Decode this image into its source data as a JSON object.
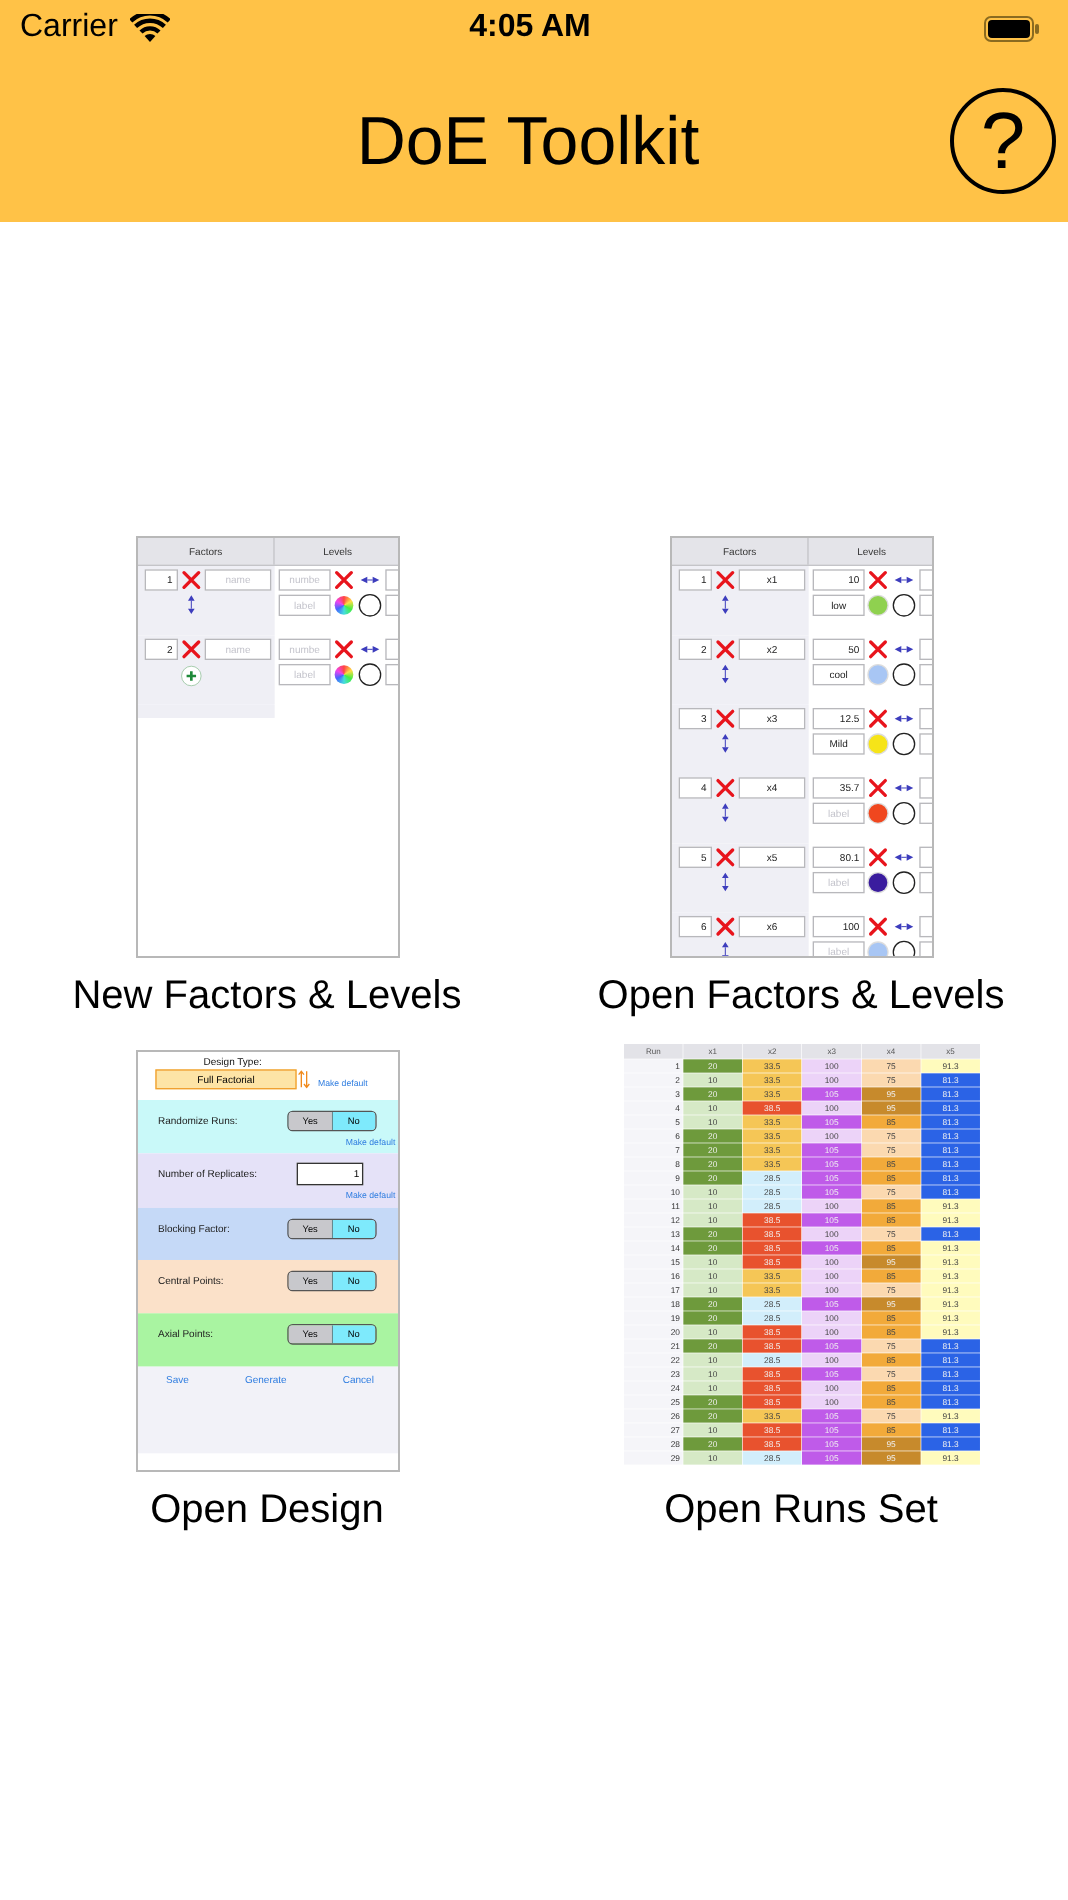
{
  "status_bar": {
    "carrier": "Carrier",
    "time": "4:05 AM"
  },
  "nav_bar": {
    "title": "DoE Toolkit",
    "help_button": "?"
  },
  "tiles": [
    {
      "kind": "factors",
      "caption": "New Factors & Levels",
      "headers": [
        "Factors",
        "Levels"
      ],
      "factors": [
        {
          "number": "1",
          "name": {
            "placeholder": "name"
          },
          "kind": "reorder",
          "level": {
            "number": {
              "placeholder": "numbe"
            },
            "label": {
              "placeholder": "label"
            }
          }
        },
        {
          "number": "2",
          "name": {
            "placeholder": "name"
          },
          "kind": "add",
          "level": {
            "number": {
              "placeholder": "numbe"
            },
            "label": {
              "placeholder": "label"
            }
          }
        }
      ]
    },
    {
      "kind": "factors",
      "caption": "Open Factors & Levels",
      "headers": [
        "Factors",
        "Levels"
      ],
      "factors": [
        {
          "number": "1",
          "name": {
            "value": "x1"
          },
          "kind": "reorder",
          "level": {
            "number": {
              "value": "10"
            },
            "label": {
              "value": "low"
            },
            "color": "#8fd14f"
          }
        },
        {
          "number": "2",
          "name": {
            "value": "x2"
          },
          "kind": "reorder",
          "level": {
            "number": {
              "value": "50"
            },
            "label": {
              "value": "cool"
            },
            "color": "#a8c6f4"
          }
        },
        {
          "number": "3",
          "name": {
            "value": "x3"
          },
          "kind": "reorder",
          "level": {
            "number": {
              "value": "12.5"
            },
            "label": {
              "value": "Mild"
            },
            "color": "#f6e418"
          }
        },
        {
          "number": "4",
          "name": {
            "value": "x4"
          },
          "kind": "reorder",
          "level": {
            "number": {
              "value": "35.7"
            },
            "label": {
              "placeholder": "label"
            },
            "color": "#f0471f"
          }
        },
        {
          "number": "5",
          "name": {
            "value": "x5"
          },
          "kind": "reorder",
          "level": {
            "number": {
              "value": "80.1"
            },
            "label": {
              "placeholder": "label"
            },
            "color": "#3a1c9e"
          }
        },
        {
          "number": "6",
          "name": {
            "value": "x6"
          },
          "kind": "reorder",
          "level": {
            "number": {
              "value": "100"
            },
            "label": {
              "placeholder": "label"
            },
            "color": "#a8c6f4"
          }
        }
      ]
    },
    {
      "kind": "design",
      "caption": "Open Design",
      "design_type_label": "Design Type:",
      "design_type": "Full Factorial",
      "make_default": "Make default",
      "sections": [
        {
          "kind": "toggle",
          "label": "Randomize Runs:",
          "color": "#c9f9f9",
          "options": [
            {
              "label": "Yes",
              "selected": false
            },
            {
              "label": "No",
              "selected": true
            }
          ],
          "make_default": "Make default"
        },
        {
          "kind": "field",
          "label": "Number of Replicates:",
          "color": "#e5e2f8",
          "value": "1",
          "make_default": "Make default"
        },
        {
          "kind": "toggle",
          "label": "Blocking Factor:",
          "color": "#c5d9f7",
          "options": [
            {
              "label": "Yes",
              "selected": false
            },
            {
              "label": "No",
              "selected": true
            }
          ]
        },
        {
          "kind": "toggle",
          "label": "Central Points:",
          "color": "#fbe1c9",
          "options": [
            {
              "label": "Yes",
              "selected": false
            },
            {
              "label": "No",
              "selected": true
            }
          ]
        },
        {
          "kind": "toggle",
          "label": "Axial Points:",
          "color": "#a9f4a1",
          "options": [
            {
              "label": "Yes",
              "selected": false
            },
            {
              "label": "No",
              "selected": true
            }
          ]
        }
      ],
      "buttons": [
        "Save",
        "Generate",
        "Cancel"
      ]
    },
    {
      "kind": "runs",
      "caption": "Open Runs Set",
      "columns": [
        "Run",
        "x1",
        "x2",
        "x3",
        "x4",
        "x5"
      ],
      "rows": [
        {
          "cells": [
            {
              "text": "1"
            },
            {
              "text": "20",
              "color": "#6e9a3c"
            },
            {
              "text": "33.5",
              "color": "#f5c656"
            },
            {
              "text": "100",
              "color": "#ecd3f8"
            },
            {
              "text": "75",
              "color": "#fbd9b0"
            },
            {
              "text": "91.3",
              "color": "#fffbbd"
            }
          ]
        },
        {
          "cells": [
            {
              "text": "2"
            },
            {
              "text": "10",
              "color": "#d6e9c6"
            },
            {
              "text": "33.5",
              "color": "#f5c656"
            },
            {
              "text": "100",
              "color": "#ecd3f8"
            },
            {
              "text": "75",
              "color": "#fbd9b0"
            },
            {
              "text": "81.3",
              "color": "#2b63e6"
            }
          ]
        },
        {
          "cells": [
            {
              "text": "3"
            },
            {
              "text": "20",
              "color": "#6e9a3c"
            },
            {
              "text": "33.5",
              "color": "#f5c656"
            },
            {
              "text": "105",
              "color": "#bf5be9"
            },
            {
              "text": "95",
              "color": "#c78a2c"
            },
            {
              "text": "81.3",
              "color": "#2b63e6"
            }
          ]
        },
        {
          "cells": [
            {
              "text": "4"
            },
            {
              "text": "10",
              "color": "#d6e9c6"
            },
            {
              "text": "38.5",
              "color": "#e8522e"
            },
            {
              "text": "100",
              "color": "#ecd3f8"
            },
            {
              "text": "95",
              "color": "#c78a2c"
            },
            {
              "text": "81.3",
              "color": "#2b63e6"
            }
          ]
        },
        {
          "cells": [
            {
              "text": "5"
            },
            {
              "text": "10",
              "color": "#d6e9c6"
            },
            {
              "text": "33.5",
              "color": "#f5c656"
            },
            {
              "text": "105",
              "color": "#bf5be9"
            },
            {
              "text": "85",
              "color": "#f2aa3a"
            },
            {
              "text": "81.3",
              "color": "#2b63e6"
            }
          ]
        },
        {
          "cells": [
            {
              "text": "6"
            },
            {
              "text": "20",
              "color": "#6e9a3c"
            },
            {
              "text": "33.5",
              "color": "#f5c656"
            },
            {
              "text": "100",
              "color": "#ecd3f8"
            },
            {
              "text": "75",
              "color": "#fbd9b0"
            },
            {
              "text": "81.3",
              "color": "#2b63e6"
            }
          ]
        },
        {
          "cells": [
            {
              "text": "7"
            },
            {
              "text": "20",
              "color": "#6e9a3c"
            },
            {
              "text": "33.5",
              "color": "#f5c656"
            },
            {
              "text": "105",
              "color": "#bf5be9"
            },
            {
              "text": "75",
              "color": "#fbd9b0"
            },
            {
              "text": "81.3",
              "color": "#2b63e6"
            }
          ]
        },
        {
          "cells": [
            {
              "text": "8"
            },
            {
              "text": "20",
              "color": "#6e9a3c"
            },
            {
              "text": "33.5",
              "color": "#f5c656"
            },
            {
              "text": "105",
              "color": "#bf5be9"
            },
            {
              "text": "85",
              "color": "#f2aa3a"
            },
            {
              "text": "81.3",
              "color": "#2b63e6"
            }
          ]
        },
        {
          "cells": [
            {
              "text": "9"
            },
            {
              "text": "20",
              "color": "#6e9a3c"
            },
            {
              "text": "28.5",
              "color": "#d2eefb"
            },
            {
              "text": "105",
              "color": "#bf5be9"
            },
            {
              "text": "85",
              "color": "#f2aa3a"
            },
            {
              "text": "81.3",
              "color": "#2b63e6"
            }
          ]
        },
        {
          "cells": [
            {
              "text": "10"
            },
            {
              "text": "10",
              "color": "#d6e9c6"
            },
            {
              "text": "28.5",
              "color": "#d2eefb"
            },
            {
              "text": "105",
              "color": "#bf5be9"
            },
            {
              "text": "75",
              "color": "#fbd9b0"
            },
            {
              "text": "81.3",
              "color": "#2b63e6"
            }
          ]
        },
        {
          "cells": [
            {
              "text": "11"
            },
            {
              "text": "10",
              "color": "#d6e9c6"
            },
            {
              "text": "28.5",
              "color": "#d2eefb"
            },
            {
              "text": "100",
              "color": "#ecd3f8"
            },
            {
              "text": "85",
              "color": "#f2aa3a"
            },
            {
              "text": "91.3",
              "color": "#fffbbd"
            }
          ]
        },
        {
          "cells": [
            {
              "text": "12"
            },
            {
              "text": "10",
              "color": "#d6e9c6"
            },
            {
              "text": "38.5",
              "color": "#e8522e"
            },
            {
              "text": "105",
              "color": "#bf5be9"
            },
            {
              "text": "85",
              "color": "#f2aa3a"
            },
            {
              "text": "91.3",
              "color": "#fffbbd"
            }
          ]
        },
        {
          "cells": [
            {
              "text": "13"
            },
            {
              "text": "20",
              "color": "#6e9a3c"
            },
            {
              "text": "38.5",
              "color": "#e8522e"
            },
            {
              "text": "100",
              "color": "#ecd3f8"
            },
            {
              "text": "75",
              "color": "#fbd9b0"
            },
            {
              "text": "81.3",
              "color": "#2b63e6"
            }
          ]
        },
        {
          "cells": [
            {
              "text": "14"
            },
            {
              "text": "20",
              "color": "#6e9a3c"
            },
            {
              "text": "38.5",
              "color": "#e8522e"
            },
            {
              "text": "105",
              "color": "#bf5be9"
            },
            {
              "text": "85",
              "color": "#f2aa3a"
            },
            {
              "text": "91.3",
              "color": "#fffbbd"
            }
          ]
        },
        {
          "cells": [
            {
              "text": "15"
            },
            {
              "text": "10",
              "color": "#d6e9c6"
            },
            {
              "text": "38.5",
              "color": "#e8522e"
            },
            {
              "text": "100",
              "color": "#ecd3f8"
            },
            {
              "text": "95",
              "color": "#c78a2c"
            },
            {
              "text": "91.3",
              "color": "#fffbbd"
            }
          ]
        },
        {
          "cells": [
            {
              "text": "16"
            },
            {
              "text": "10",
              "color": "#d6e9c6"
            },
            {
              "text": "33.5",
              "color": "#f5c656"
            },
            {
              "text": "100",
              "color": "#ecd3f8"
            },
            {
              "text": "85",
              "color": "#f2aa3a"
            },
            {
              "text": "91.3",
              "color": "#fffbbd"
            }
          ]
        },
        {
          "cells": [
            {
              "text": "17"
            },
            {
              "text": "10",
              "color": "#d6e9c6"
            },
            {
              "text": "33.5",
              "color": "#f5c656"
            },
            {
              "text": "100",
              "color": "#ecd3f8"
            },
            {
              "text": "75",
              "color": "#fbd9b0"
            },
            {
              "text": "91.3",
              "color": "#fffbbd"
            }
          ]
        },
        {
          "cells": [
            {
              "text": "18"
            },
            {
              "text": "20",
              "color": "#6e9a3c"
            },
            {
              "text": "28.5",
              "color": "#d2eefb"
            },
            {
              "text": "105",
              "color": "#bf5be9"
            },
            {
              "text": "95",
              "color": "#c78a2c"
            },
            {
              "text": "91.3",
              "color": "#fffbbd"
            }
          ]
        },
        {
          "cells": [
            {
              "text": "19"
            },
            {
              "text": "20",
              "color": "#6e9a3c"
            },
            {
              "text": "28.5",
              "color": "#d2eefb"
            },
            {
              "text": "100",
              "color": "#ecd3f8"
            },
            {
              "text": "85",
              "color": "#f2aa3a"
            },
            {
              "text": "91.3",
              "color": "#fffbbd"
            }
          ]
        },
        {
          "cells": [
            {
              "text": "20"
            },
            {
              "text": "10",
              "color": "#d6e9c6"
            },
            {
              "text": "38.5",
              "color": "#e8522e"
            },
            {
              "text": "100",
              "color": "#ecd3f8"
            },
            {
              "text": "85",
              "color": "#f2aa3a"
            },
            {
              "text": "91.3",
              "color": "#fffbbd"
            }
          ]
        },
        {
          "cells": [
            {
              "text": "21"
            },
            {
              "text": "20",
              "color": "#6e9a3c"
            },
            {
              "text": "38.5",
              "color": "#e8522e"
            },
            {
              "text": "105",
              "color": "#bf5be9"
            },
            {
              "text": "75",
              "color": "#fbd9b0"
            },
            {
              "text": "81.3",
              "color": "#2b63e6"
            }
          ]
        },
        {
          "cells": [
            {
              "text": "22"
            },
            {
              "text": "10",
              "color": "#d6e9c6"
            },
            {
              "text": "28.5",
              "color": "#d2eefb"
            },
            {
              "text": "100",
              "color": "#ecd3f8"
            },
            {
              "text": "85",
              "color": "#f2aa3a"
            },
            {
              "text": "81.3",
              "color": "#2b63e6"
            }
          ]
        },
        {
          "cells": [
            {
              "text": "23"
            },
            {
              "text": "10",
              "color": "#d6e9c6"
            },
            {
              "text": "38.5",
              "color": "#e8522e"
            },
            {
              "text": "105",
              "color": "#bf5be9"
            },
            {
              "text": "75",
              "color": "#fbd9b0"
            },
            {
              "text": "81.3",
              "color": "#2b63e6"
            }
          ]
        },
        {
          "cells": [
            {
              "text": "24"
            },
            {
              "text": "10",
              "color": "#d6e9c6"
            },
            {
              "text": "38.5",
              "color": "#e8522e"
            },
            {
              "text": "100",
              "color": "#ecd3f8"
            },
            {
              "text": "85",
              "color": "#f2aa3a"
            },
            {
              "text": "81.3",
              "color": "#2b63e6"
            }
          ]
        },
        {
          "cells": [
            {
              "text": "25"
            },
            {
              "text": "20",
              "color": "#6e9a3c"
            },
            {
              "text": "38.5",
              "color": "#e8522e"
            },
            {
              "text": "100",
              "color": "#ecd3f8"
            },
            {
              "text": "85",
              "color": "#f2aa3a"
            },
            {
              "text": "81.3",
              "color": "#2b63e6"
            }
          ]
        },
        {
          "cells": [
            {
              "text": "26"
            },
            {
              "text": "20",
              "color": "#6e9a3c"
            },
            {
              "text": "33.5",
              "color": "#f5c656"
            },
            {
              "text": "105",
              "color": "#bf5be9"
            },
            {
              "text": "75",
              "color": "#fbd9b0"
            },
            {
              "text": "91.3",
              "color": "#fffbbd"
            }
          ]
        },
        {
          "cells": [
            {
              "text": "27"
            },
            {
              "text": "10",
              "color": "#d6e9c6"
            },
            {
              "text": "38.5",
              "color": "#e8522e"
            },
            {
              "text": "105",
              "color": "#bf5be9"
            },
            {
              "text": "85",
              "color": "#f2aa3a"
            },
            {
              "text": "81.3",
              "color": "#2b63e6"
            }
          ]
        },
        {
          "cells": [
            {
              "text": "28"
            },
            {
              "text": "20",
              "color": "#6e9a3c"
            },
            {
              "text": "38.5",
              "color": "#e8522e"
            },
            {
              "text": "105",
              "color": "#bf5be9"
            },
            {
              "text": "95",
              "color": "#c78a2c"
            },
            {
              "text": "81.3",
              "color": "#2b63e6"
            }
          ]
        },
        {
          "cells": [
            {
              "text": "29"
            },
            {
              "text": "10",
              "color": "#d6e9c6"
            },
            {
              "text": "28.5",
              "color": "#d2eefb"
            },
            {
              "text": "105",
              "color": "#bf5be9"
            },
            {
              "text": "95",
              "color": "#c78a2c"
            },
            {
              "text": "91.3",
              "color": "#fffbbd"
            }
          ]
        }
      ]
    }
  ]
}
